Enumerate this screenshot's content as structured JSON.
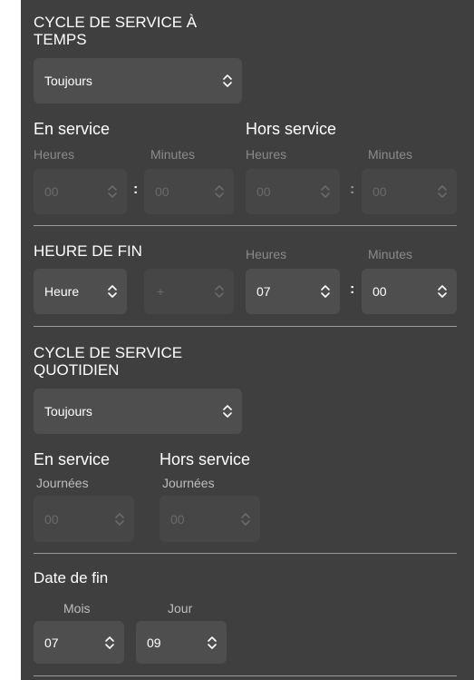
{
  "timed_cycle": {
    "title_line1": "CYCLE DE SERVICE À",
    "title_line2": "TEMPS",
    "mode_value": "Toujours",
    "on_label": "En service",
    "off_label": "Hors service",
    "hours_label": "Heures",
    "minutes_label": "Minutes",
    "on_hours": "00",
    "on_minutes": "00",
    "off_hours": "00",
    "off_minutes": "00",
    "separator": ":"
  },
  "end_time": {
    "title": "HEURE DE FIN",
    "hours_label": "Heures",
    "minutes_label": "Minutes",
    "type_value": "Heure",
    "offset_value": "+",
    "hours_value": "07",
    "minutes_value": "00",
    "separator": ":"
  },
  "daily_cycle": {
    "title_line1": "CYCLE DE SERVICE",
    "title_line2": "QUOTIDIEN",
    "mode_value": "Toujours",
    "on_label": "En service",
    "off_label": "Hors service",
    "days_label": "Journées",
    "on_days": "00",
    "off_days": "00"
  },
  "end_date": {
    "title": "Date de fin",
    "month_label": "Mois",
    "day_label": "Jour",
    "month_value": "07",
    "day_value": "09"
  },
  "icons": {
    "stepper": "chevron-up-down-icon"
  },
  "colors": {
    "panel": "#3f3f3f",
    "control": "#4e4e4e",
    "disabled": "#464646",
    "text": "#ffffff",
    "muted": "#8a8a8a"
  }
}
